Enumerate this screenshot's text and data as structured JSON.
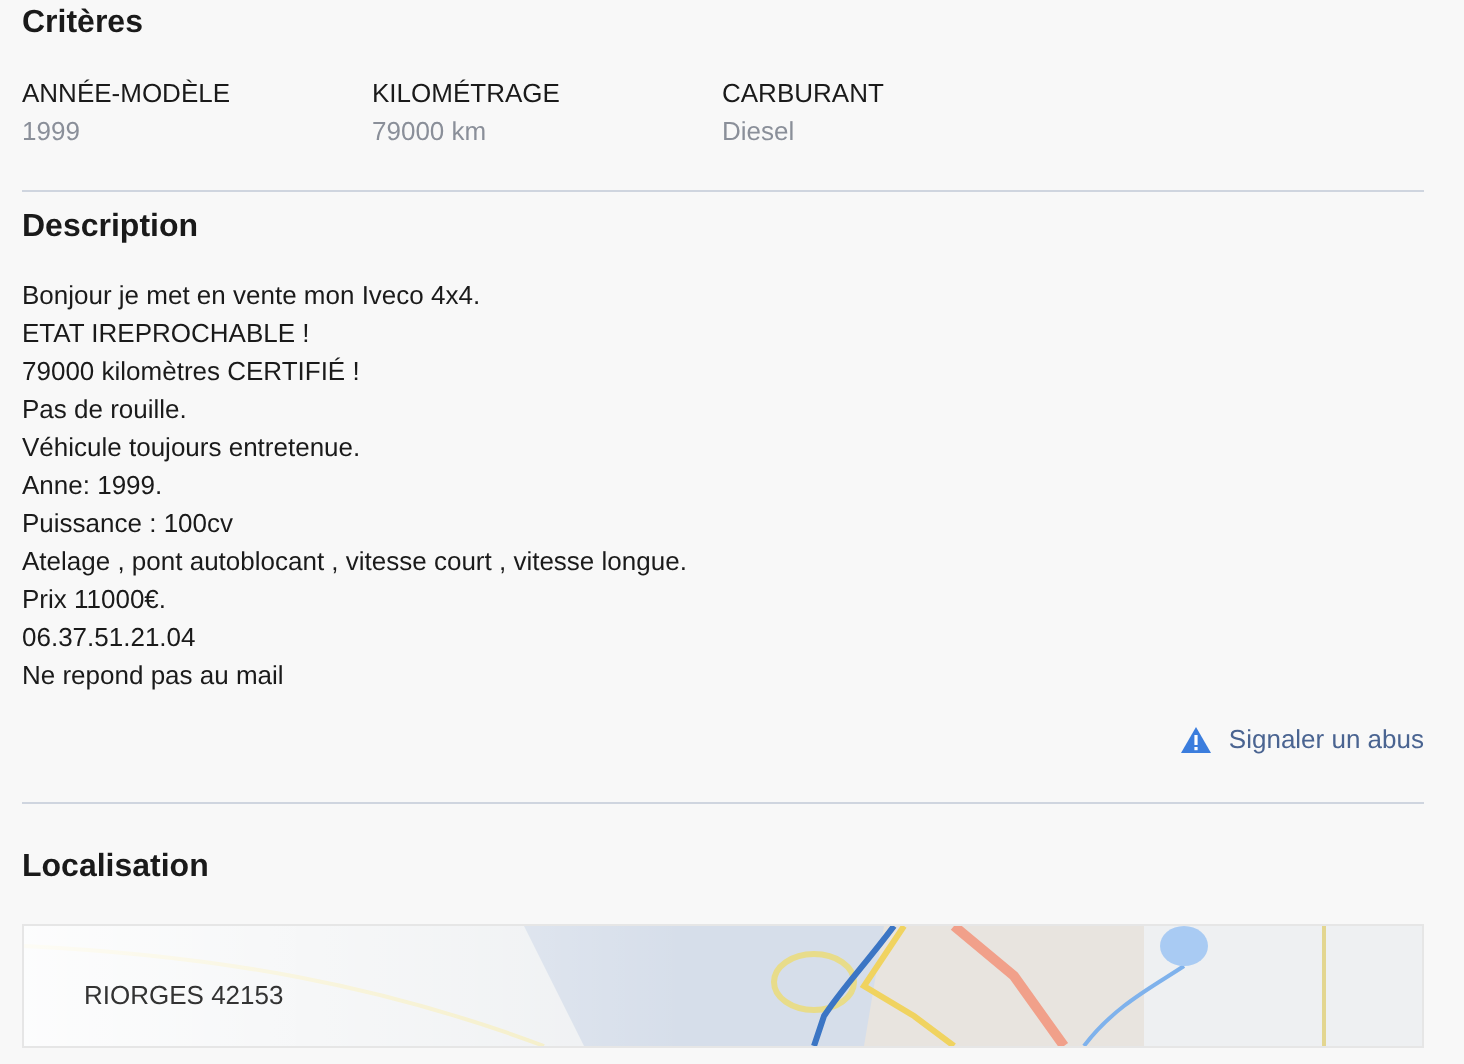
{
  "criteria": {
    "title": "Critères",
    "items": [
      {
        "label": "ANNÉE-MODÈLE",
        "value": "1999"
      },
      {
        "label": "KILOMÉTRAGE",
        "value": "79000 km"
      },
      {
        "label": "CARBURANT",
        "value": "Diesel"
      }
    ]
  },
  "description": {
    "title": "Description",
    "lines": [
      "Bonjour je met en vente mon Iveco 4x4.",
      "ETAT IREPROCHABLE !",
      "79000 kilomètres CERTIFIÉ !",
      "Pas de rouille.",
      "Véhicule toujours entretenue.",
      "Anne: 1999.",
      "Puissance : 100cv",
      "Atelage , pont autoblocant , vitesse court , vitesse longue.",
      "Prix 11000€.",
      "06.37.51.21.04",
      "Ne repond pas au mail"
    ],
    "report_link": "Signaler un abus"
  },
  "location": {
    "title": "Localisation",
    "place": "RIORGES 42153"
  }
}
